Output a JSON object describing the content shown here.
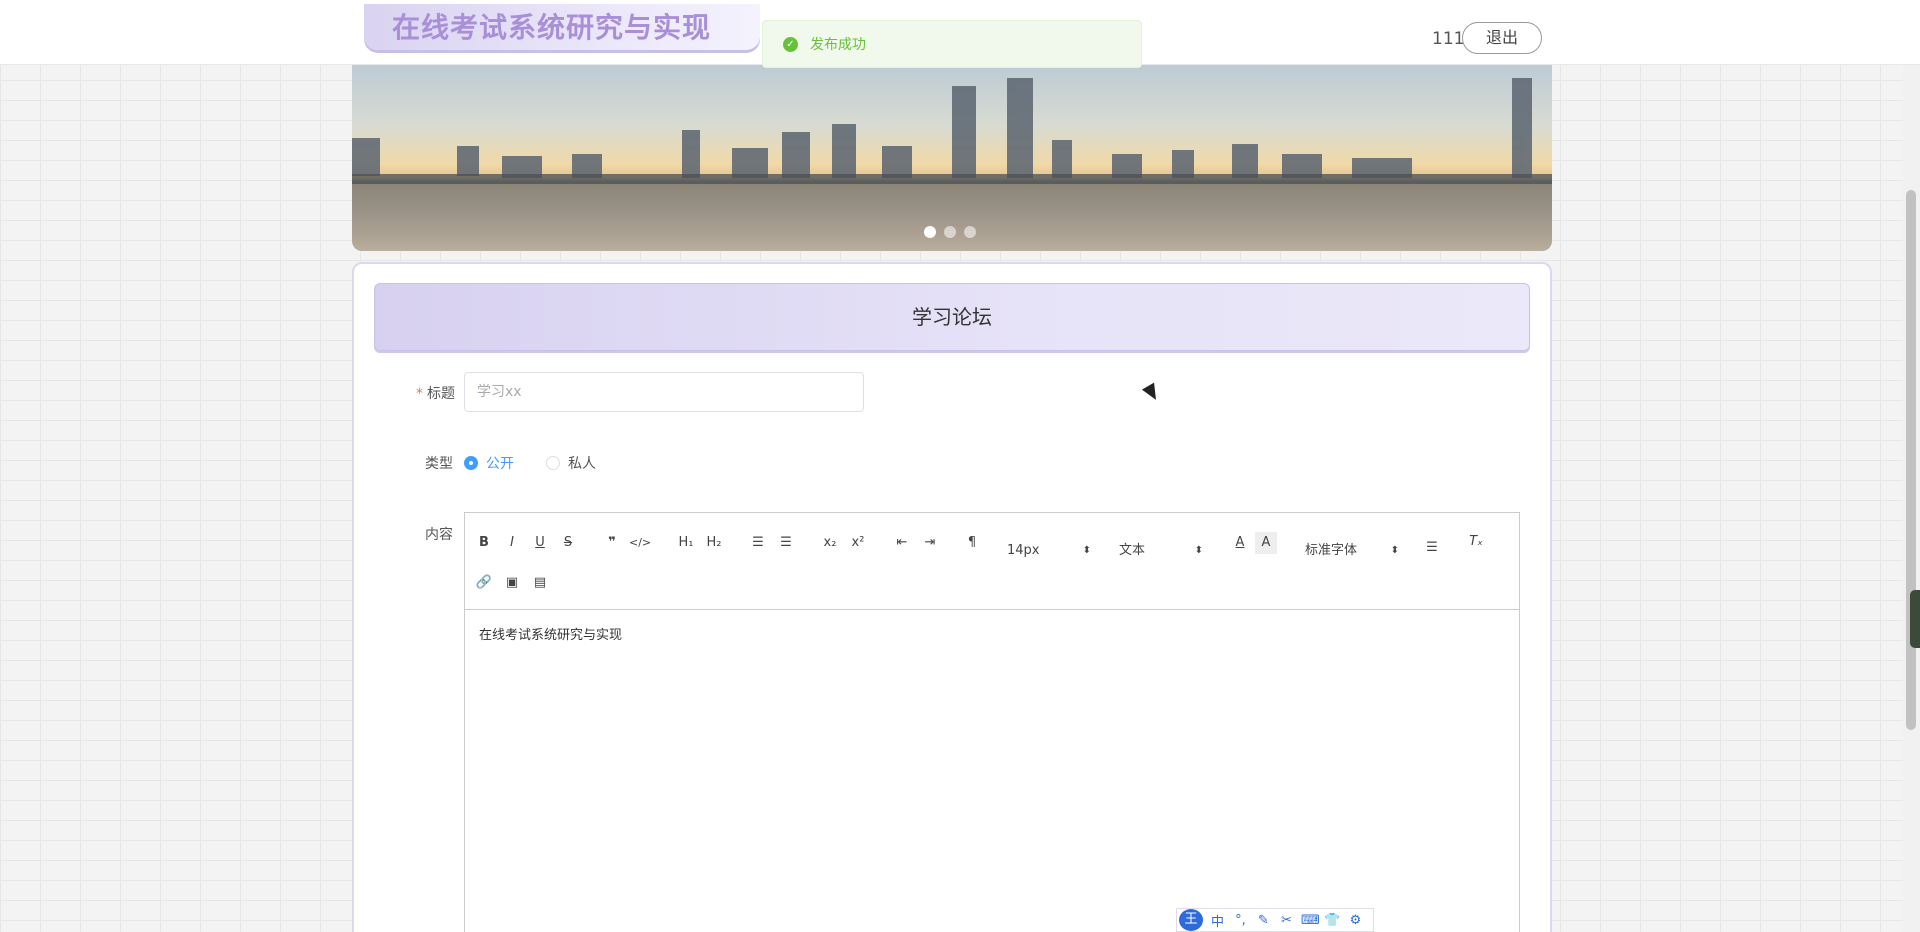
{
  "header": {
    "title": "在线考试系统研究与实现",
    "username": "111",
    "logout_label": "退出"
  },
  "toast": {
    "icon": "check-circle-icon",
    "message": "发布成功",
    "color": "#67c23a"
  },
  "carousel": {
    "dots": 3,
    "active_index": 0
  },
  "forum": {
    "heading": "学习论坛",
    "title_label": "标题",
    "title_placeholder": "学习xx",
    "type_label": "类型",
    "type_options": [
      "公开",
      "私人"
    ],
    "type_selected": "公开",
    "content_label": "内容"
  },
  "editor": {
    "font_size": "14px",
    "block_type": "文本",
    "font_family": "标准字体",
    "content": "在线考试系统研究与实现",
    "toolbar_icons": [
      "bold-icon",
      "italic-icon",
      "underline-icon",
      "strikethrough-icon",
      "blockquote-icon",
      "code-icon",
      "h1-icon",
      "h2-icon",
      "ordered-list-icon",
      "bullet-list-icon",
      "subscript-icon",
      "superscript-icon",
      "outdent-icon",
      "indent-icon",
      "text-direction-icon",
      "font-color-icon",
      "background-color-icon",
      "align-icon",
      "clear-format-icon",
      "link-icon",
      "image-icon",
      "video-icon"
    ]
  },
  "ime": {
    "logo": "王",
    "mode": "中"
  },
  "colors": {
    "accent": "#409eff",
    "brand": "#a98fd8",
    "success": "#67c23a"
  }
}
